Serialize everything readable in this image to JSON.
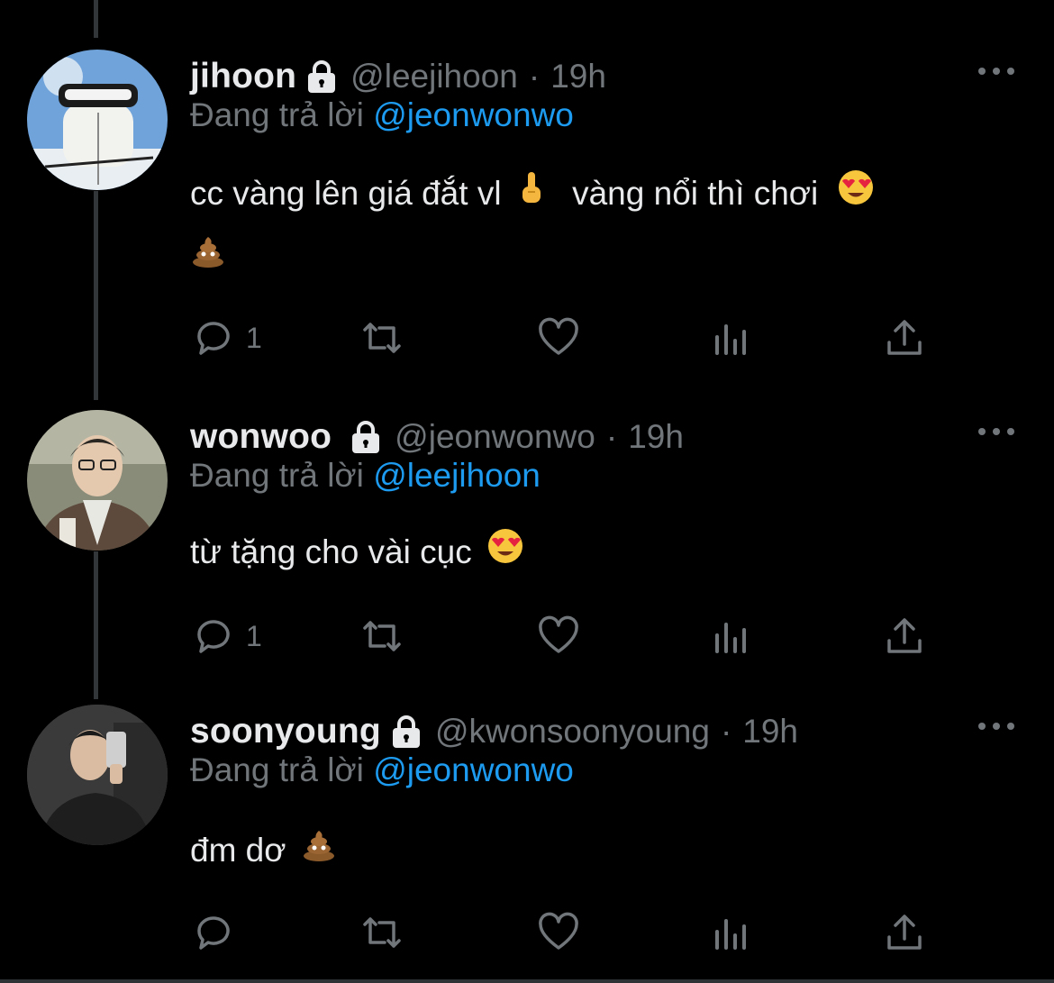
{
  "colors": {
    "background": "#000000",
    "text": "#e7e9ea",
    "muted": "#71767b",
    "link": "#1d9bf0",
    "thread_line": "#333639"
  },
  "tweets": [
    {
      "name": "jihoon",
      "handle": "@leejihoon",
      "dot": "·",
      "time": "19h",
      "replying_prefix": "Đang trả lời ",
      "replying_to": "@jeonwonwo",
      "text_line1": "cc vàng lên giá đắt vl",
      "emoji1": "middle-finger-emoji",
      "text_line1b": "vàng nổi thì chơi",
      "emoji2": "heart-eyes-emoji",
      "emoji3": "poop-emoji",
      "reply_count": "1",
      "verified_lock": "lock-icon"
    },
    {
      "name": "wonwoo",
      "handle": "@jeonwonwo",
      "dot": "·",
      "time": "19h",
      "replying_prefix": "Đang trả lời ",
      "replying_to": "@leejihoon",
      "text": "từ tặng cho vài cục",
      "emoji": "heart-eyes-emoji",
      "reply_count": "1",
      "verified_lock": "lock-icon"
    },
    {
      "name": "soonyoung",
      "handle": "@kwonsoonyoung",
      "dot": "·",
      "time": "19h",
      "replying_prefix": "Đang trả lời ",
      "replying_to": "@jeonwonwo",
      "text": "đm dơ",
      "emoji": "poop-emoji",
      "reply_count": "",
      "verified_lock": "lock-icon"
    }
  ]
}
